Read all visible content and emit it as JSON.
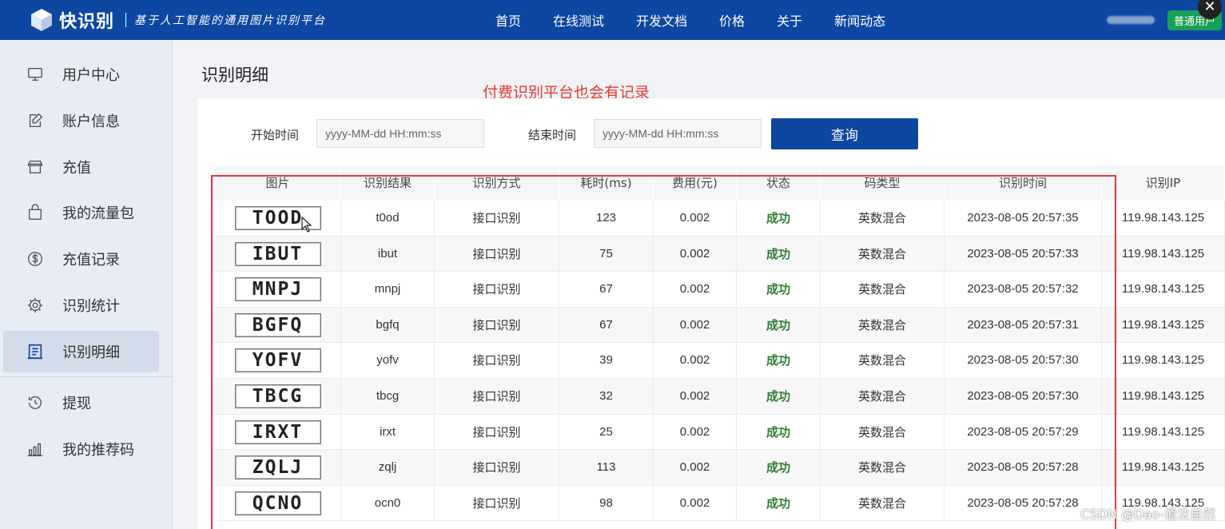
{
  "header": {
    "logo_text": "快识别",
    "slogan": "基于人工智能的通用图片识别平台",
    "nav": [
      "首页",
      "在线测试",
      "开发文档",
      "价格",
      "关于",
      "新闻动态"
    ],
    "user_badge": "普通用户",
    "close_symbol": "✕"
  },
  "sidebar": {
    "items": [
      {
        "label": "用户中心",
        "icon": "monitor-icon"
      },
      {
        "label": "账户信息",
        "icon": "edit-icon"
      },
      {
        "label": "充值",
        "icon": "store-icon"
      },
      {
        "label": "我的流量包",
        "icon": "bag-icon"
      },
      {
        "label": "充值记录",
        "icon": "dollar-icon"
      },
      {
        "label": "识别统计",
        "icon": "gear-icon"
      },
      {
        "label": "识别明细",
        "icon": "receipt-icon",
        "active": true
      },
      {
        "label": "提现",
        "icon": "history-icon"
      },
      {
        "label": "我的推荐码",
        "icon": "bar-chart-icon"
      }
    ]
  },
  "main": {
    "title": "识别明细",
    "annotation": "付费识别平台也会有记录",
    "filter": {
      "start_label": "开始时间",
      "start_placeholder": "yyyy-MM-dd HH:mm:ss",
      "end_label": "结束时间",
      "end_placeholder": "yyyy-MM-dd HH:mm:ss",
      "query_label": "查询"
    },
    "table": {
      "columns": [
        "图片",
        "识别结果",
        "识别方式",
        "耗时(ms)",
        "费用(元)",
        "状态",
        "码类型",
        "识别时间",
        "识别IP"
      ],
      "rows": [
        {
          "captcha": "TOOD",
          "result": "t0od",
          "method": "接口识别",
          "time_ms": "123",
          "cost": "0.002",
          "status": "成功",
          "type": "英数混合",
          "time": "2023-08-05 20:57:35",
          "ip": "119.98.143.125"
        },
        {
          "captcha": "IBUT",
          "result": "ibut",
          "method": "接口识别",
          "time_ms": "75",
          "cost": "0.002",
          "status": "成功",
          "type": "英数混合",
          "time": "2023-08-05 20:57:33",
          "ip": "119.98.143.125"
        },
        {
          "captcha": "MNPJ",
          "result": "mnpj",
          "method": "接口识别",
          "time_ms": "67",
          "cost": "0.002",
          "status": "成功",
          "type": "英数混合",
          "time": "2023-08-05 20:57:32",
          "ip": "119.98.143.125"
        },
        {
          "captcha": "BGFQ",
          "result": "bgfq",
          "method": "接口识别",
          "time_ms": "67",
          "cost": "0.002",
          "status": "成功",
          "type": "英数混合",
          "time": "2023-08-05 20:57:31",
          "ip": "119.98.143.125"
        },
        {
          "captcha": "YOFV",
          "result": "yofv",
          "method": "接口识别",
          "time_ms": "39",
          "cost": "0.002",
          "status": "成功",
          "type": "英数混合",
          "time": "2023-08-05 20:57:30",
          "ip": "119.98.143.125"
        },
        {
          "captcha": "TBCG",
          "result": "tbcg",
          "method": "接口识别",
          "time_ms": "32",
          "cost": "0.002",
          "status": "成功",
          "type": "英数混合",
          "time": "2023-08-05 20:57:30",
          "ip": "119.98.143.125"
        },
        {
          "captcha": "IRXT",
          "result": "irxt",
          "method": "接口识别",
          "time_ms": "25",
          "cost": "0.002",
          "status": "成功",
          "type": "英数混合",
          "time": "2023-08-05 20:57:29",
          "ip": "119.98.143.125"
        },
        {
          "captcha": "ZQLJ",
          "result": "zqlj",
          "method": "接口识别",
          "time_ms": "113",
          "cost": "0.002",
          "status": "成功",
          "type": "英数混合",
          "time": "2023-08-05 20:57:28",
          "ip": "119.98.143.125"
        },
        {
          "captcha": "QCNO",
          "result": "ocn0",
          "method": "接口识别",
          "time_ms": "98",
          "cost": "0.002",
          "status": "成功",
          "type": "英数混合",
          "time": "2023-08-05 20:57:28",
          "ip": "119.98.143.125"
        }
      ]
    }
  },
  "watermark": "CSDN @Dao-道法自然",
  "colors": {
    "primary": "#0d47a1",
    "success": "#2e7d32",
    "annotation": "#e53935",
    "badge": "#18a058"
  }
}
